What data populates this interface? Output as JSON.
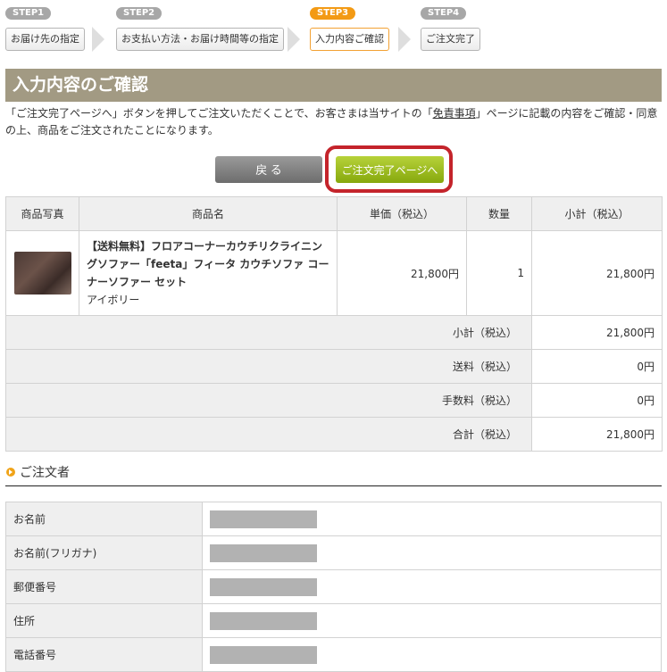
{
  "steps": [
    {
      "num": "STEP1",
      "label": "お届け先の指定"
    },
    {
      "num": "STEP2",
      "label": "お支払い方法・お届け時間等の指定"
    },
    {
      "num": "STEP3",
      "label": "入力内容ご確認"
    },
    {
      "num": "STEP4",
      "label": "ご注文完了"
    }
  ],
  "page_title": "入力内容のご確認",
  "intro": {
    "text1": "「ご注文完了ページへ」ボタンを押してご注文いただくことで、お客さまは当サイトの「",
    "link": "免責事項",
    "text2": "」ページに記載の内容をご確認・同意の上、商品をご注文されたことになります。"
  },
  "buttons": {
    "back": "戻 る",
    "complete": "ご注文完了ページへ"
  },
  "cart": {
    "headers": [
      "商品写真",
      "商品名",
      "単価（税込）",
      "数量",
      "小計（税込）"
    ],
    "item": {
      "name_bold": "【送料無料】フロアコーナーカウチリクライニングソファー「feeta」フィータ カウチソファ コーナーソファー セット",
      "variant": "アイボリー",
      "unit_price": "21,800円",
      "qty": "1",
      "subtotal": "21,800円"
    },
    "summary": [
      {
        "label": "小計（税込）",
        "value": "21,800円"
      },
      {
        "label": "送料（税込）",
        "value": "0円"
      },
      {
        "label": "手数料（税込）",
        "value": "0円"
      },
      {
        "label": "合計（税込）",
        "value": "21,800円"
      }
    ]
  },
  "orderer": {
    "heading": "ご注文者",
    "fields": [
      "お名前",
      "お名前(フリガナ)",
      "郵便番号",
      "住所",
      "電話番号"
    ]
  },
  "colors": {
    "accent": "#f39a14",
    "title_bar": "#a29a83",
    "complete_button": "#9bbd1e",
    "highlight": "#c4242b",
    "total": "#cc1111"
  }
}
